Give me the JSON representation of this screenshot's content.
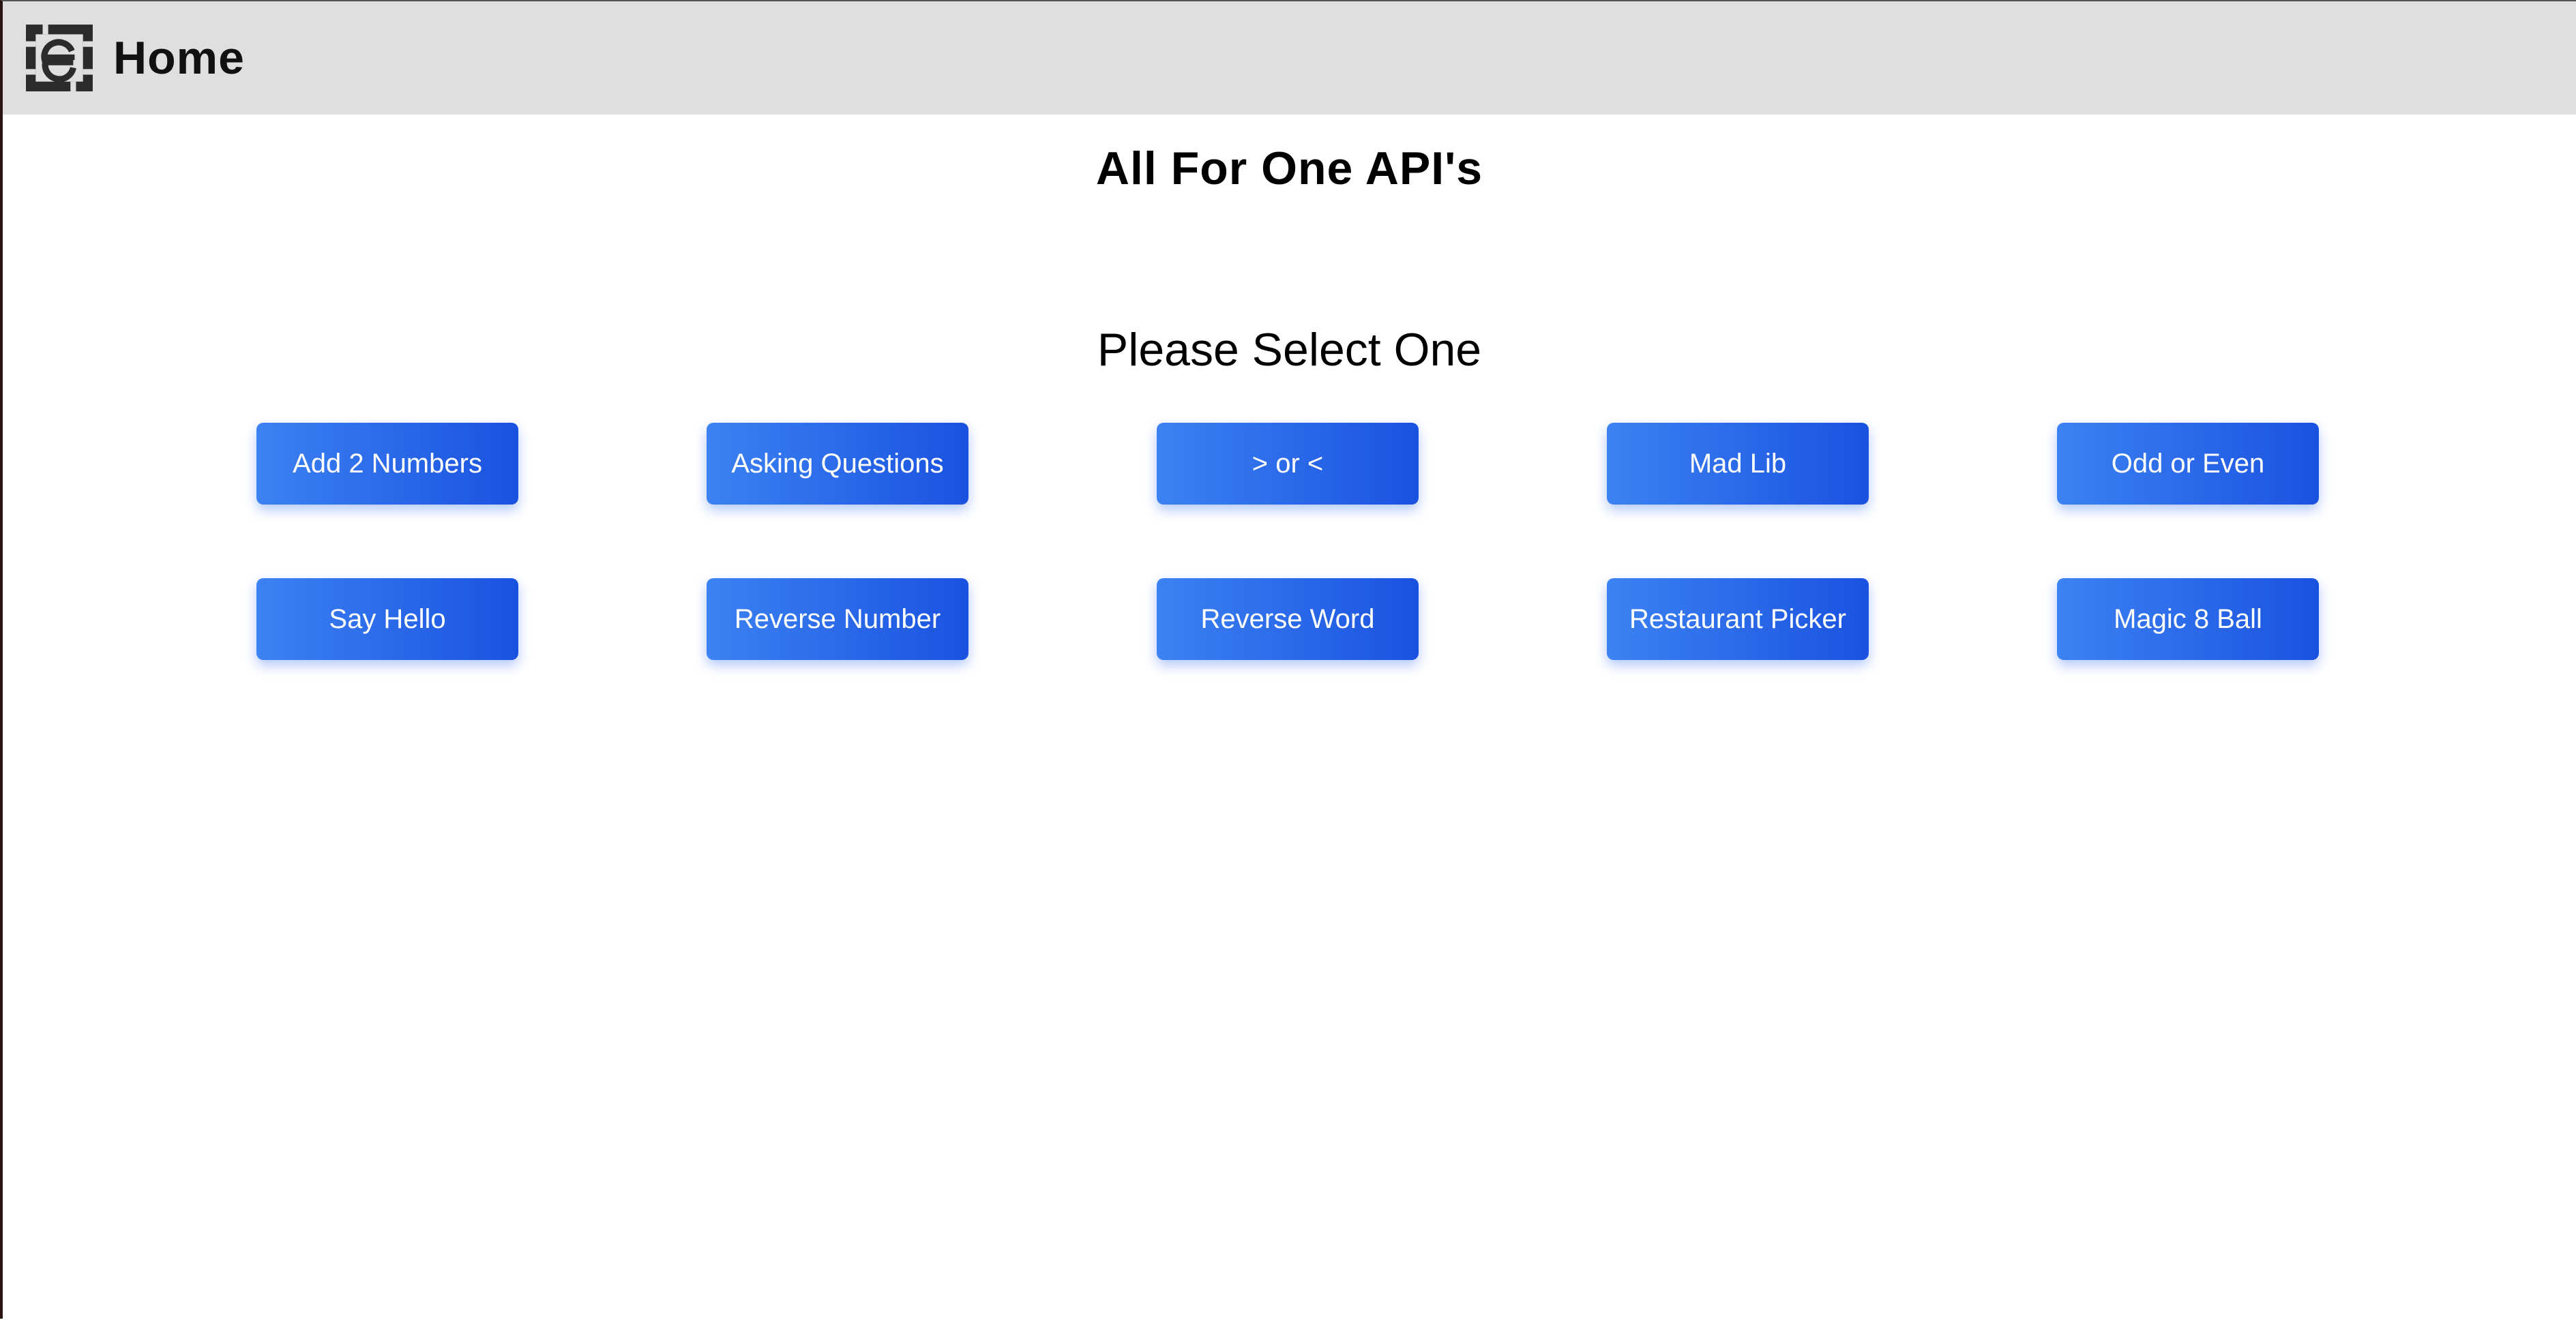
{
  "navbar": {
    "logo_icon": "e-monogram-logo",
    "title": "Home"
  },
  "main": {
    "title": "All For One API's",
    "subtitle": "Please Select One",
    "buttons": [
      {
        "label": "Add 2 Numbers"
      },
      {
        "label": "Asking Questions"
      },
      {
        "label": "> or <"
      },
      {
        "label": "Mad Lib"
      },
      {
        "label": "Odd or Even"
      },
      {
        "label": "Say Hello"
      },
      {
        "label": "Reverse Number"
      },
      {
        "label": "Reverse Word"
      },
      {
        "label": "Restaurant Picker"
      },
      {
        "label": "Magic 8 Ball"
      }
    ]
  },
  "colors": {
    "navbar_bg": "#dfdfdf",
    "button_gradient_start": "#3c82f2",
    "button_gradient_end": "#1a52e0",
    "button_text": "#ffffff"
  }
}
